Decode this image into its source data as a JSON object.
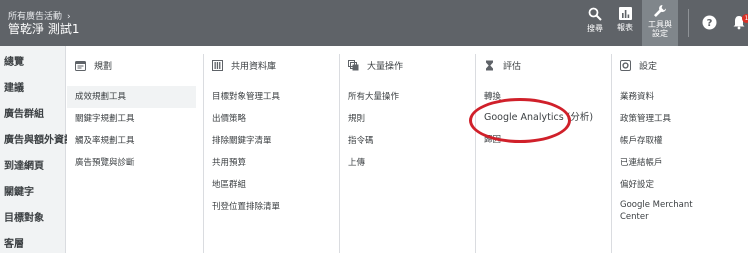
{
  "header": {
    "breadcrumb": "所有廣告活動",
    "account": "管乾淨 測試1",
    "search_label": "搜尋",
    "reports_label": "報表",
    "tools_label": "工具與\n設定",
    "notification_count": "1"
  },
  "leftnav": {
    "items": [
      "總覽",
      "建議",
      "廣告群組",
      "廣告與額外資訊",
      "到達網頁",
      "關鍵字",
      "目標對象",
      "客層"
    ]
  },
  "menu": {
    "columns": [
      {
        "heading": "規劃",
        "icon": "calendar-icon",
        "items": [
          "成效規劃工具",
          "關鍵字規劃工具",
          "觸及率規劃工具",
          "廣告預覽與診斷"
        ]
      },
      {
        "heading": "共用資料庫",
        "icon": "library-icon",
        "items": [
          "目標對象管理工具",
          "出價策略",
          "排除關鍵字清單",
          "共用預算",
          "地區群組",
          "刊登位置排除清單"
        ]
      },
      {
        "heading": "大量操作",
        "icon": "bulk-icon",
        "items": [
          "所有大量操作",
          "規則",
          "指令碼",
          "上傳"
        ]
      },
      {
        "heading": "評估",
        "icon": "hourglass-icon",
        "items": [
          "轉換",
          "Google Analytics (分析)",
          "歸因"
        ]
      },
      {
        "heading": "設定",
        "icon": "settings-icon",
        "items": [
          "業務資料",
          "政策管理工具",
          "帳戶存取權",
          "已連結帳戶",
          "偏好設定",
          "Google Merchant Center"
        ]
      }
    ]
  }
}
